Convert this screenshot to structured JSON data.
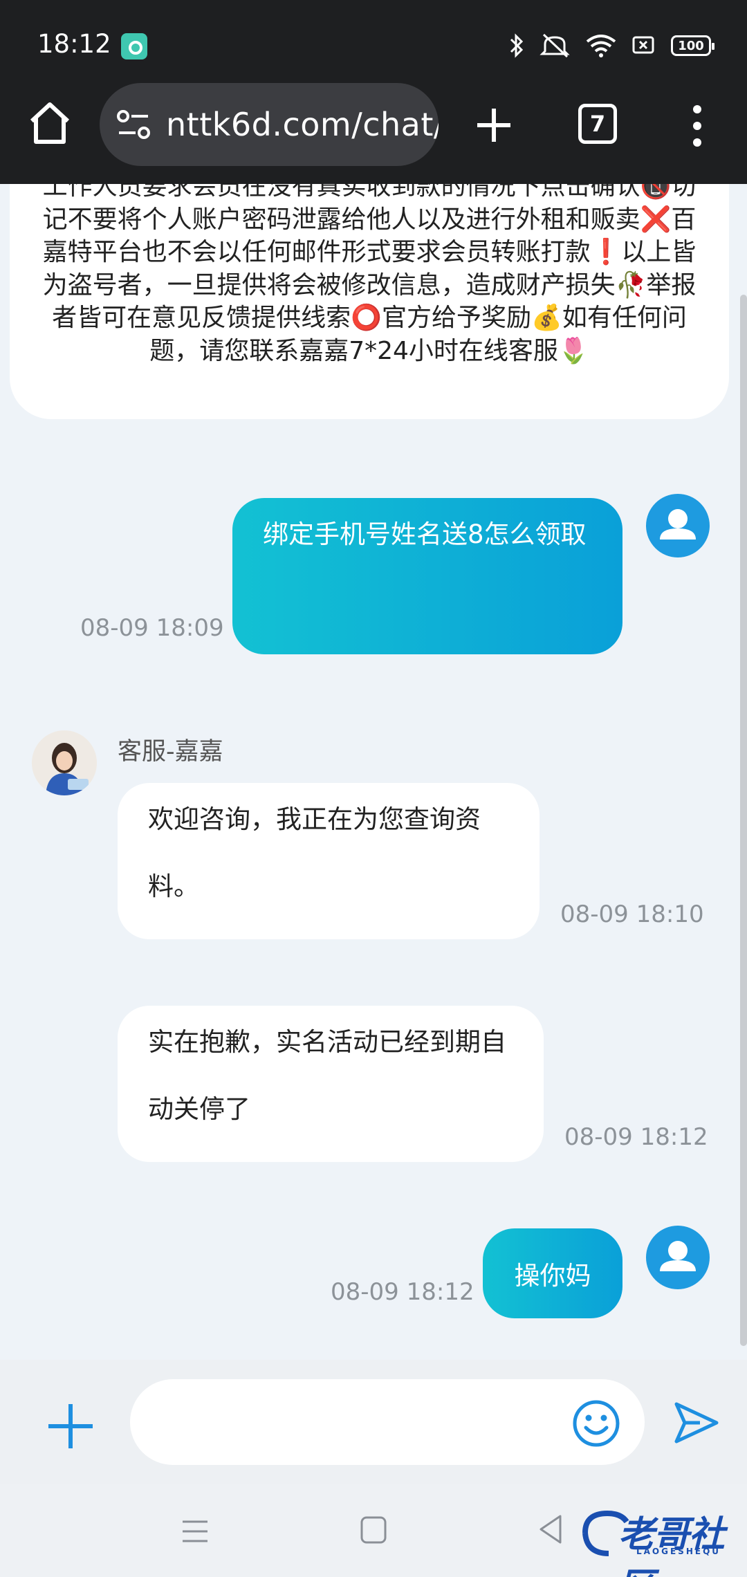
{
  "status_bar": {
    "time": "18:12",
    "battery": "100",
    "icons": [
      "app-notification-icon",
      "bluetooth-icon",
      "mute-icon",
      "wifi-icon",
      "screen-cast-icon",
      "battery-icon"
    ]
  },
  "browser": {
    "url": "nttk6d.com/chat/",
    "tab_count": "7",
    "icons": [
      "home-icon",
      "site-settings-icon",
      "new-tab-icon",
      "tabs-icon",
      "more-icon"
    ]
  },
  "notice": {
    "text": "工作人员要求会员在没有真实收到款的情况下点击确认📵切记不要将个人账户密码泄露给他人以及进行外租和贩卖❌百嘉特平台也不会以任何邮件形式要求会员转账打款❗以上皆为盗号者，一旦提供将会被修改信息，造成财产损失🥀举报者皆可在意见反馈提供线索⭕官方给予奖励💰如有任何问题，请您联系嘉嘉7*24小时在线客服🌷"
  },
  "messages": [
    {
      "direction": "out",
      "text": "绑定手机号姓名送8怎么领取",
      "time": "08-09 18:09"
    },
    {
      "direction": "in",
      "sender": "客服-嘉嘉",
      "text": "欢迎咨询，我正在为您查询资料。",
      "time": "08-09 18:10"
    },
    {
      "direction": "in",
      "text": "实在抱歉，实名活动已经到期自动关停了",
      "time": "08-09 18:12"
    },
    {
      "direction": "out",
      "text": "操你妈",
      "time": "08-09 18:12"
    }
  ],
  "composer": {
    "placeholder": "",
    "icons": [
      "add-icon",
      "emoji-icon",
      "send-icon"
    ]
  },
  "watermark": {
    "text": "老哥社区",
    "sub": "LAOGESHEQU"
  },
  "colors": {
    "status_bg": "#1e1f21",
    "chat_bg": "#eef3f8",
    "outgoing_gradient_start": "#13c1d3",
    "outgoing_gradient_end": "#0aa0d8",
    "accent": "#1e9be0"
  }
}
